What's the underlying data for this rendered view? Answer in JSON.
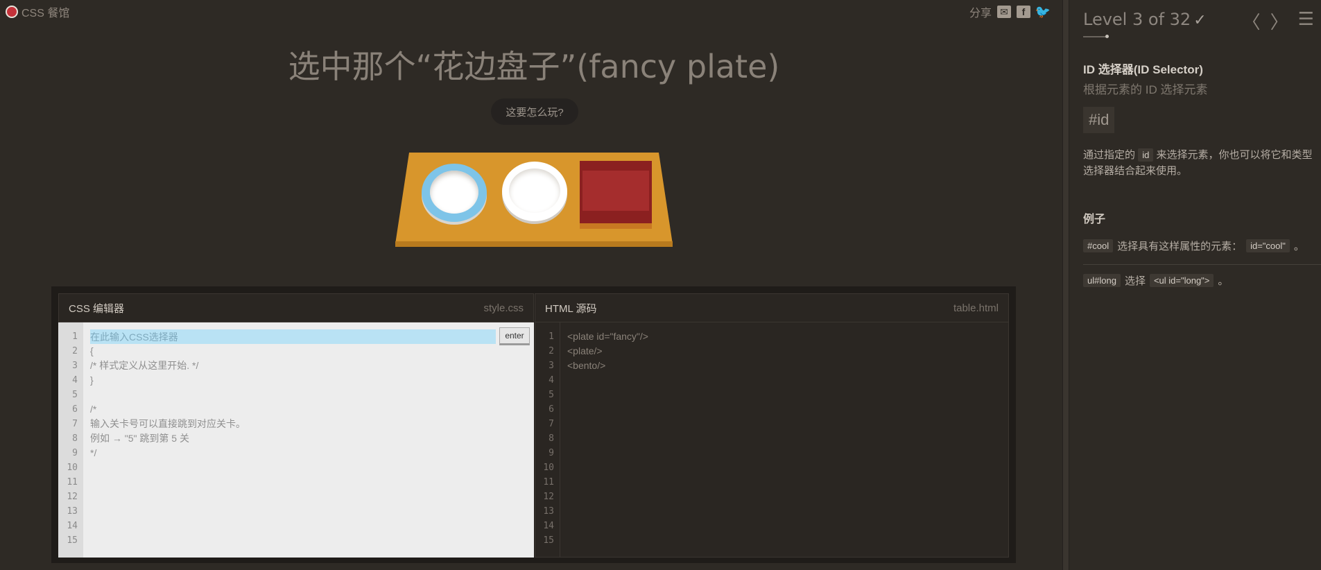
{
  "header": {
    "logo_text": "CSS 餐馆",
    "share_label": "分享",
    "share_icons": [
      "mail-icon",
      "facebook-icon",
      "twitter-icon"
    ]
  },
  "title": "选中那个“花边盘子”(fancy plate)",
  "help_button": "这要怎么玩?",
  "table": {
    "items": [
      "plate-fancy",
      "plate",
      "bento"
    ]
  },
  "css_editor": {
    "title": "CSS 编辑器",
    "file": "style.css",
    "placeholder": "在此输入CSS选择器",
    "enter_label": "enter",
    "line_numbers": [
      "1",
      "2",
      "3",
      "4",
      "5",
      "6",
      "7",
      "8",
      "9",
      "10",
      "11",
      "12",
      "13",
      "14",
      "15"
    ],
    "lines": [
      "",
      "{",
      "/* 样式定义从这里开始. */",
      "}",
      "",
      "/*",
      "输入关卡号可以直接跳到对应关卡。",
      "例如 → \"5\" 跳到第 5 关",
      "*/"
    ]
  },
  "html_viewer": {
    "title": "HTML 源码",
    "file": "table.html",
    "line_numbers": [
      "1",
      "2",
      "3",
      "4",
      "5",
      "6",
      "7",
      "8",
      "9",
      "10",
      "11",
      "12",
      "13",
      "14",
      "15"
    ],
    "lines": [
      "<plate id=\"fancy\"/>",
      "<plate/>",
      "<bento/>"
    ]
  },
  "sidebar": {
    "level_title": "Level 3 of 32",
    "check": "✓",
    "prev": "〈",
    "next": "〉",
    "menu": "☰",
    "selector_name": "ID 选择器(ID Selector)",
    "selector_desc": "根据元素的 ID 选择元素",
    "syntax": "#id",
    "explain_before": "通过指定的",
    "explain_tag": "id",
    "explain_after": "来选择元素，你也可以将它和类型选择器结合起来使用。",
    "examples_heading": "例子",
    "example1": {
      "code": "#cool",
      "text": "选择具有这样属性的元素：",
      "attr": "id=\"cool\"",
      "end": "。"
    },
    "example2": {
      "code": "ul#long",
      "text": "选择",
      "attr": "<ul id=\"long\">",
      "end": "。"
    }
  },
  "colors": {
    "background": "#2e2a25",
    "table_wood": "#d8962c",
    "plate_rim_fancy": "#7ec4e8",
    "bento": "#8b2020",
    "input_highlight": "#b9e2f4"
  }
}
